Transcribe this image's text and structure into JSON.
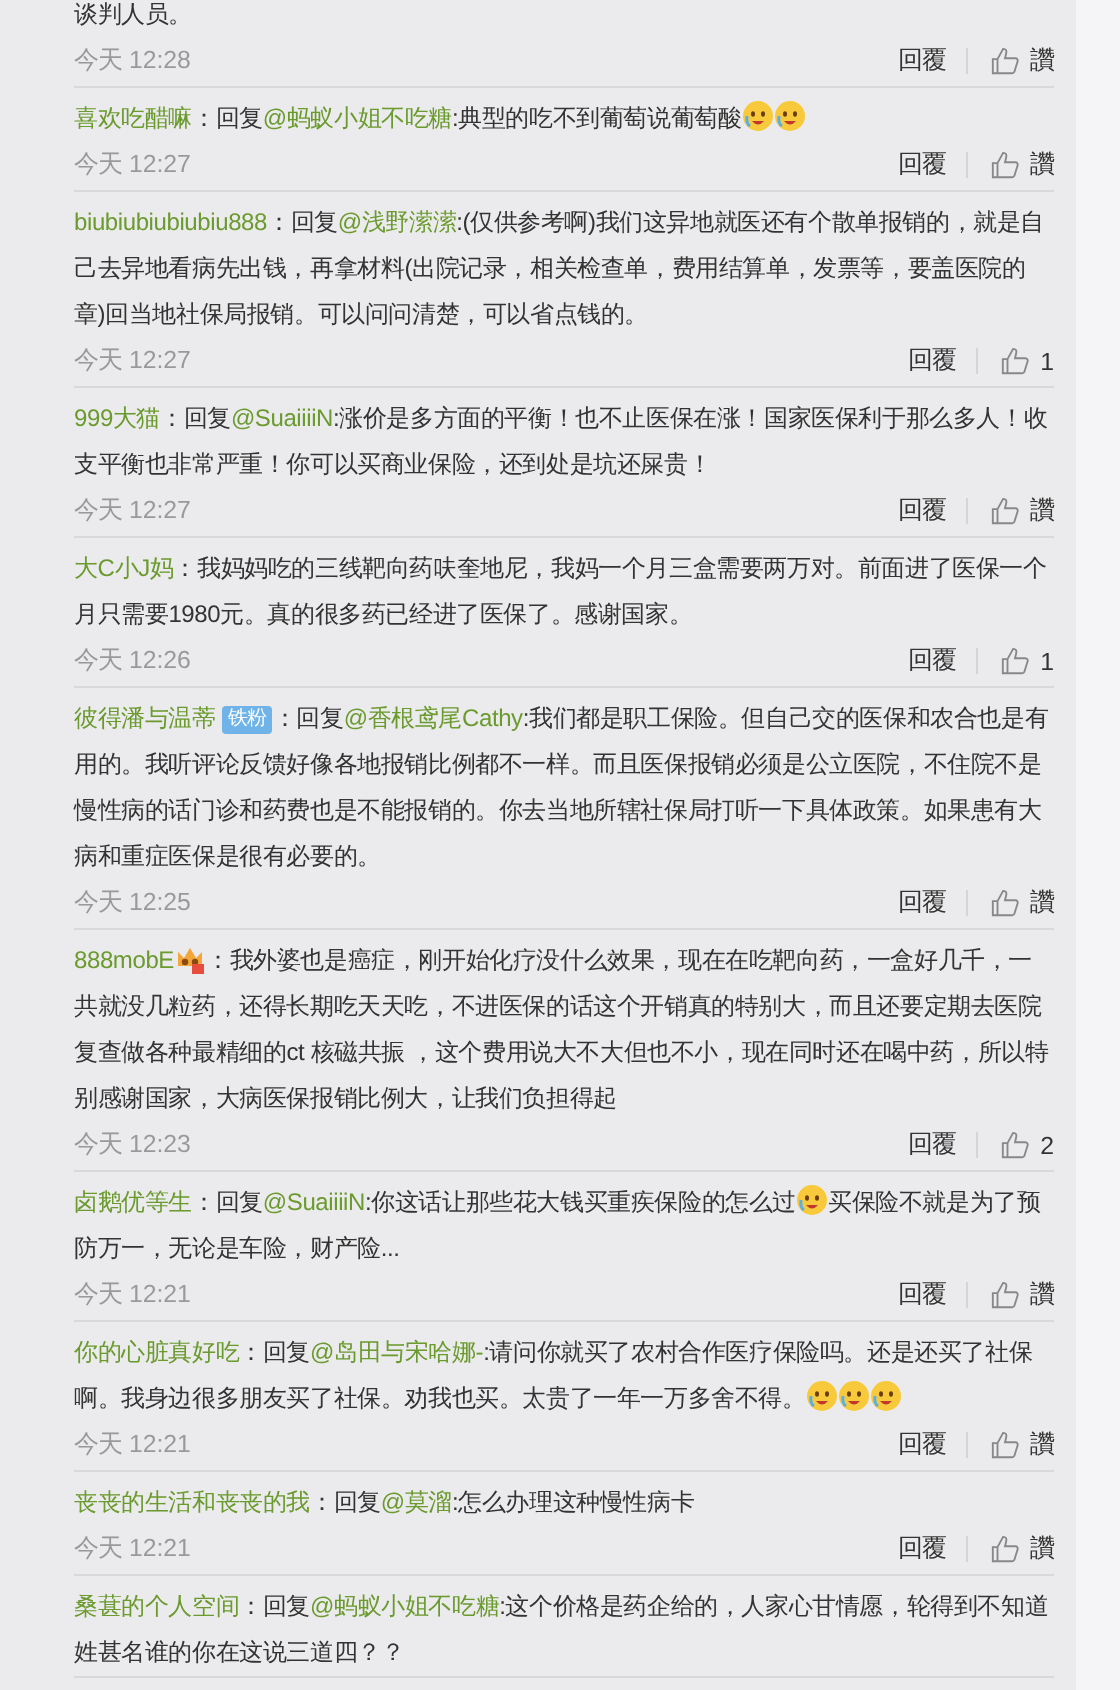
{
  "comments": [
    {
      "segments": [
        {
          "kind": "text",
          "text": "谈判人员。"
        }
      ],
      "time": "今天 12:28",
      "reply_label": "回覆",
      "likes": "讚"
    },
    {
      "segments": [
        {
          "kind": "user",
          "text": "喜欢吃醋嘛"
        },
        {
          "kind": "text",
          "text": "：回复"
        },
        {
          "kind": "mention",
          "text": "@蚂蚁小姐不吃糖"
        },
        {
          "kind": "text",
          "text": ":典型的吃不到葡萄说葡萄酸"
        },
        {
          "kind": "emoji"
        },
        {
          "kind": "emoji"
        }
      ],
      "time": "今天 12:27",
      "reply_label": "回覆",
      "likes": "讚"
    },
    {
      "segments": [
        {
          "kind": "user",
          "text": "biubiubiubiubiu888"
        },
        {
          "kind": "text",
          "text": "：回复"
        },
        {
          "kind": "mention",
          "text": "@浅野潆潆"
        },
        {
          "kind": "text",
          "text": ":(仅供参考啊)我们这异地就医还有个散单报销的，就是自己去异地看病先出钱，再拿材料(出院记录，相关检查单，费用结算单，发票等，要盖医院的章)回当地社保局报销。可以问问清楚，可以省点钱的。"
        }
      ],
      "time": "今天 12:27",
      "reply_label": "回覆",
      "likes": "1"
    },
    {
      "segments": [
        {
          "kind": "user",
          "text": "999大猫"
        },
        {
          "kind": "text",
          "text": "：回复"
        },
        {
          "kind": "mention",
          "text": "@SuaiiiiN"
        },
        {
          "kind": "text",
          "text": ":涨价是多方面的平衡！也不止医保在涨！国家医保利于那么多人！收支平衡也非常严重！你可以买商业保险，还到处是坑还屎贵！"
        }
      ],
      "time": "今天 12:27",
      "reply_label": "回覆",
      "likes": "讚"
    },
    {
      "segments": [
        {
          "kind": "user",
          "text": "大C小J妈"
        },
        {
          "kind": "text",
          "text": "：我妈妈吃的三线靶向药呋奎地尼，我妈一个月三盒需要两万对。前面进了医保一个月只需要1980元。真的很多药已经进了医保了。感谢国家。"
        }
      ],
      "time": "今天 12:26",
      "reply_label": "回覆",
      "likes": "1"
    },
    {
      "segments": [
        {
          "kind": "user",
          "text": "彼得潘与温蒂"
        },
        {
          "kind": "badge",
          "text": "铁粉"
        },
        {
          "kind": "text",
          "text": "：回复"
        },
        {
          "kind": "mention",
          "text": "@香根鸢尾Cathy"
        },
        {
          "kind": "text",
          "text": ":我们都是职工保险。但自己交的医保和农合也是有用的。我听评论反馈好像各地报销比例都不一样。而且医保报销必须是公立医院，不住院不是慢性病的话门诊和药费也是不能报销的。你去当地所辖社保局打听一下具体政策。如果患有大病和重症医保是很有必要的。"
        }
      ],
      "time": "今天 12:25",
      "reply_label": "回覆",
      "likes": "讚"
    },
    {
      "segments": [
        {
          "kind": "user",
          "text": "888mobE"
        },
        {
          "kind": "level-icon"
        },
        {
          "kind": "text",
          "text": "：我外婆也是癌症，刚开始化疗没什么效果，现在在吃靶向药，一盒好几千，一共就没几粒药，还得长期吃天天吃，不进医保的话这个开销真的特别大，而且还要定期去医院复查做各种最精细的ct 核磁共振 ，这个费用说大不大但也不小，现在同时还在喝中药，所以特别感谢国家，大病医保报销比例大，让我们负担得起"
        }
      ],
      "time": "今天 12:23",
      "reply_label": "回覆",
      "likes": "2"
    },
    {
      "segments": [
        {
          "kind": "user",
          "text": "卤鹅优等生"
        },
        {
          "kind": "text",
          "text": "：回复"
        },
        {
          "kind": "mention",
          "text": "@SuaiiiiN"
        },
        {
          "kind": "text",
          "text": ":你这话让那些花大钱买重疾保险的怎么过"
        },
        {
          "kind": "emoji"
        },
        {
          "kind": "text",
          "text": "买保险不就是为了预防万一，无论是车险，财产险..."
        }
      ],
      "time": "今天 12:21",
      "reply_label": "回覆",
      "likes": "讚"
    },
    {
      "segments": [
        {
          "kind": "user",
          "text": "你的心脏真好吃"
        },
        {
          "kind": "text",
          "text": "：回复"
        },
        {
          "kind": "mention",
          "text": "@岛田与宋哈娜-"
        },
        {
          "kind": "text",
          "text": ":请问你就买了农村合作医疗保险吗。还是还买了社保啊。我身边很多朋友买了社保。劝我也买。太贵了一年一万多舍不得。"
        },
        {
          "kind": "emoji"
        },
        {
          "kind": "emoji"
        },
        {
          "kind": "emoji"
        }
      ],
      "time": "今天 12:21",
      "reply_label": "回覆",
      "likes": "讚"
    },
    {
      "segments": [
        {
          "kind": "user",
          "text": "丧丧的生活和丧丧的我"
        },
        {
          "kind": "text",
          "text": "：回复"
        },
        {
          "kind": "mention",
          "text": "@莫溜"
        },
        {
          "kind": "text",
          "text": ":怎么办理这种慢性病卡"
        }
      ],
      "time": "今天 12:21",
      "reply_label": "回覆",
      "likes": "讚"
    },
    {
      "segments": [
        {
          "kind": "user",
          "text": "桑葚的个人空间"
        },
        {
          "kind": "text",
          "text": "：回复"
        },
        {
          "kind": "mention",
          "text": "@蚂蚁小姐不吃糖"
        },
        {
          "kind": "text",
          "text": ":这个价格是药企给的，人家心甘情愿，轮得到不知道姓甚名谁的你在这说三道四？？"
        }
      ]
    }
  ]
}
